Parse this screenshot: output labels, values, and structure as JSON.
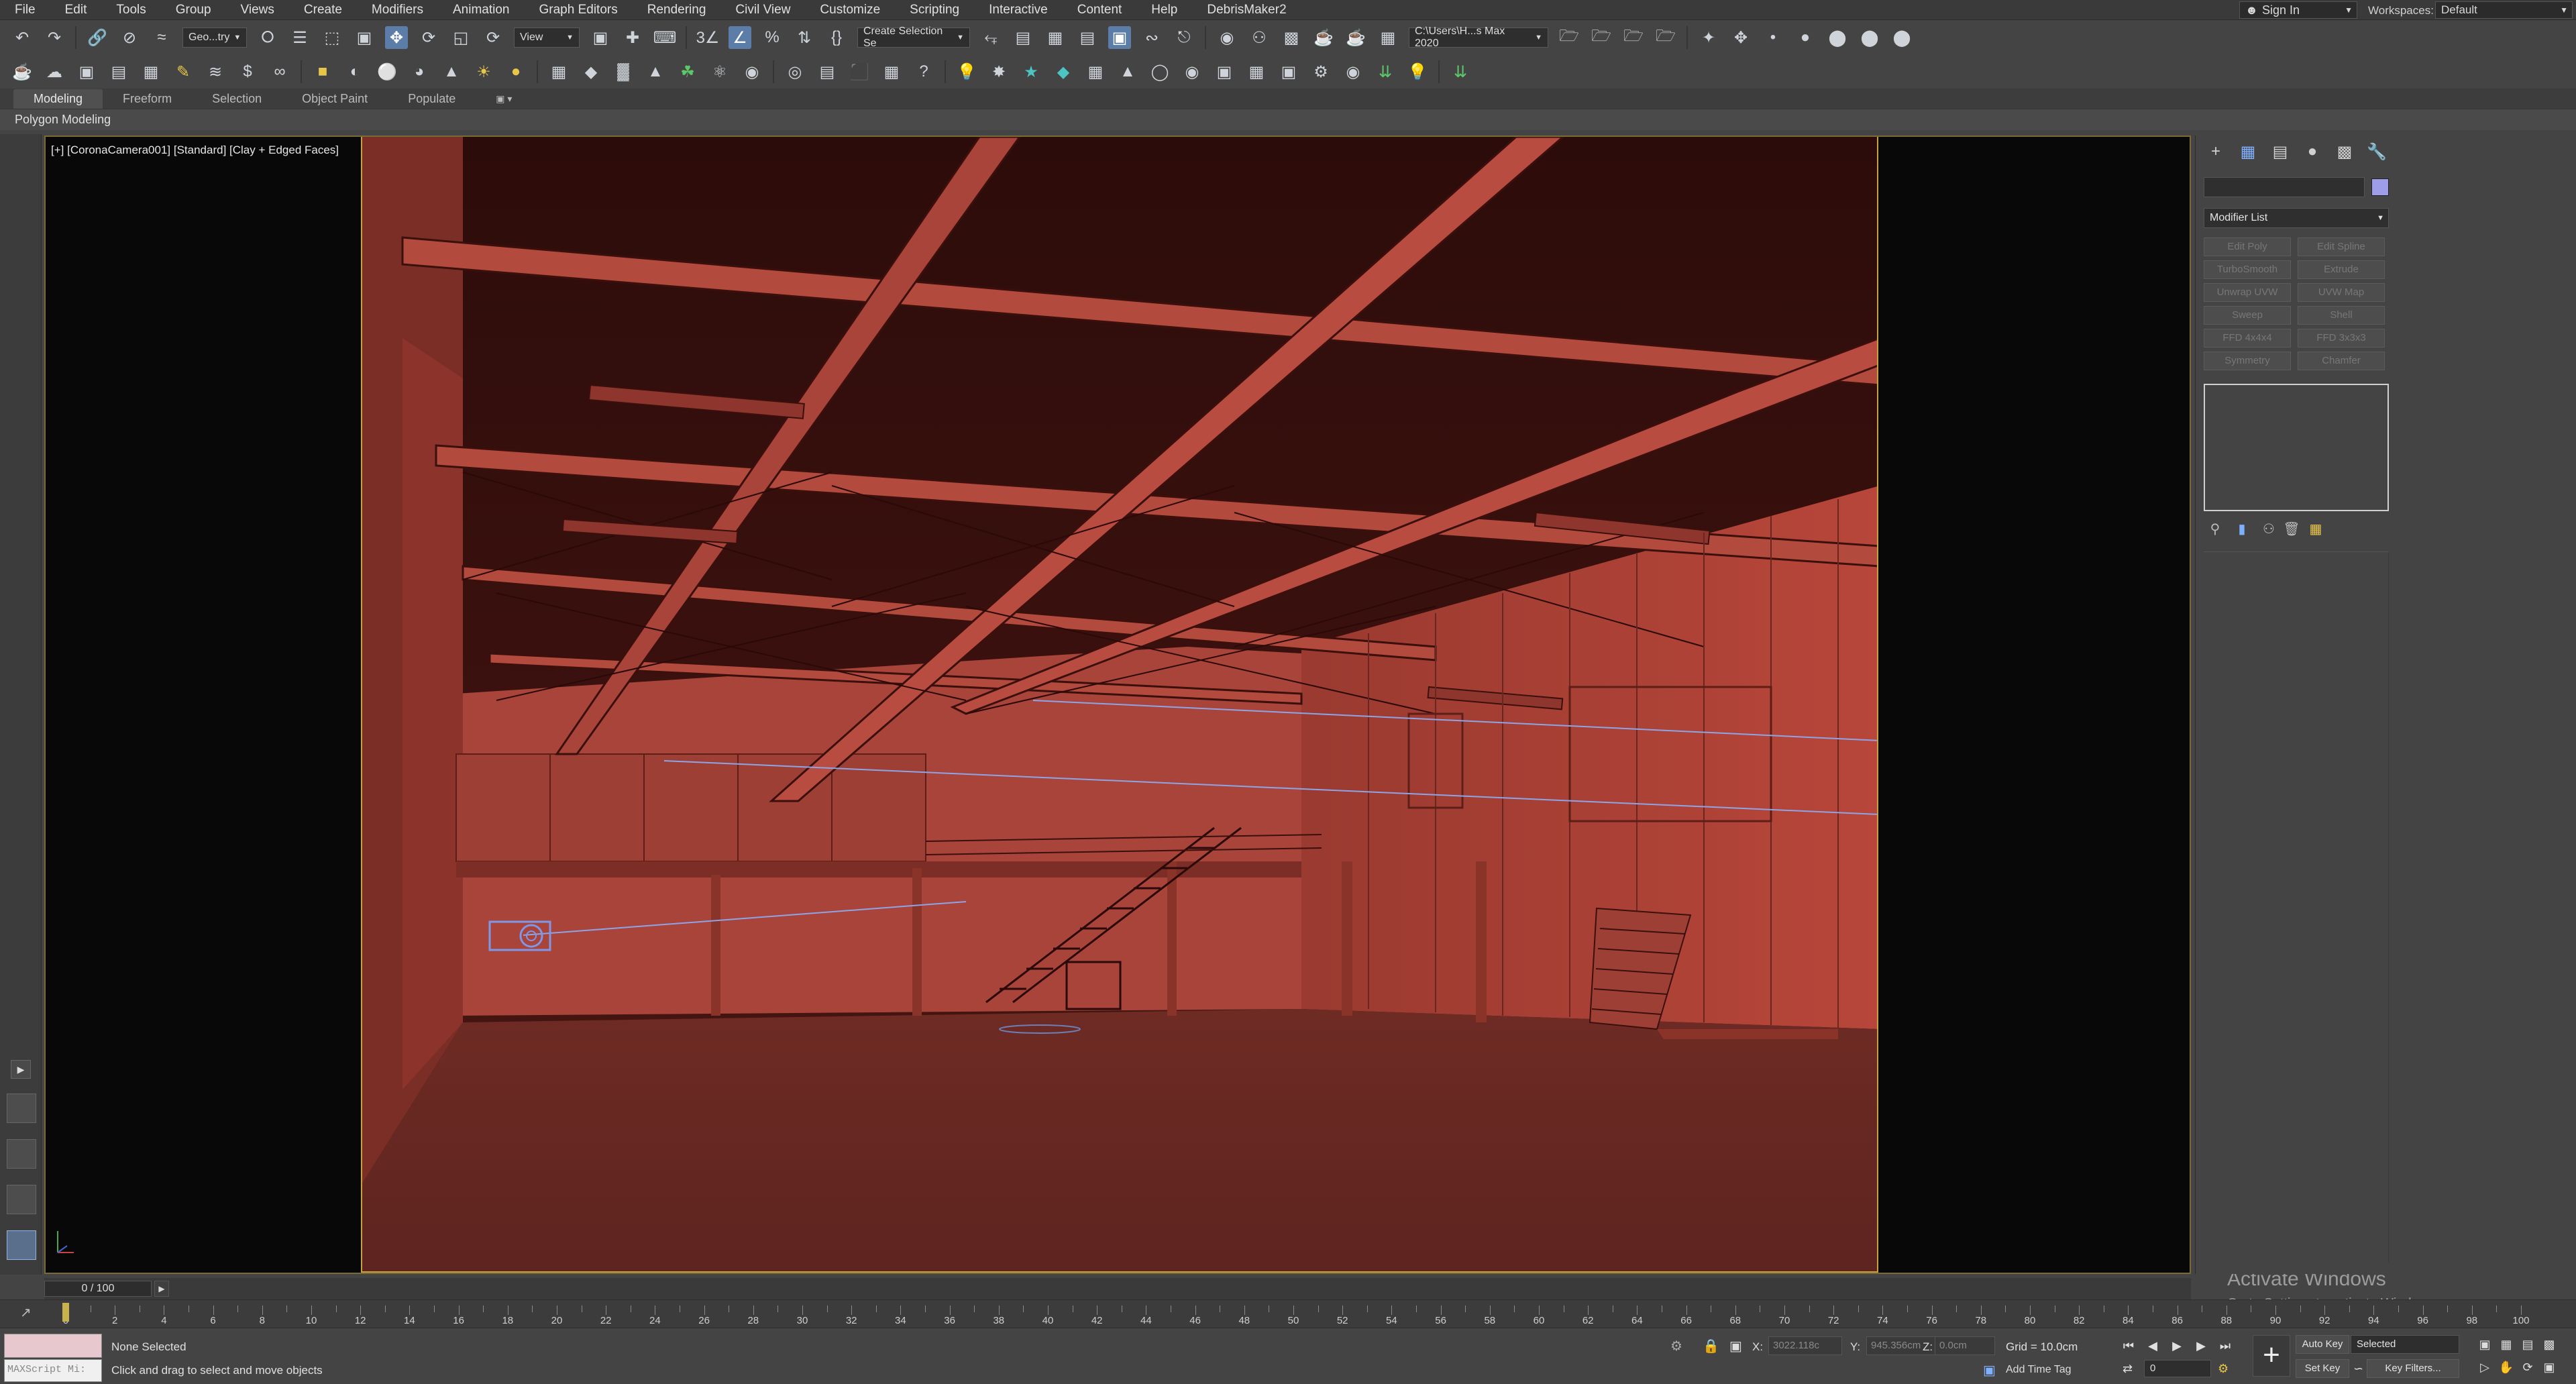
{
  "menu": [
    "File",
    "Edit",
    "Tools",
    "Group",
    "Views",
    "Create",
    "Modifiers",
    "Animation",
    "Graph Editors",
    "Rendering",
    "Civil View",
    "Customize",
    "Scripting",
    "Interactive",
    "Content",
    "Help",
    "DebrisMaker2"
  ],
  "account": {
    "sign_in": "Sign In",
    "workspaces_label": "Workspaces:",
    "workspace": "Default"
  },
  "toolbar1": {
    "geometry_filter": "Geo...try",
    "ref_coord": "View",
    "selection_set": "Create Selection Se",
    "project_path": "C:\\Users\\H...s Max 2020"
  },
  "ribbon": {
    "tabs": [
      "Modeling",
      "Freeform",
      "Selection",
      "Object Paint",
      "Populate"
    ],
    "active_tab": "Modeling",
    "panel_title": "Polygon Modeling"
  },
  "viewport": {
    "label": "[+] [CoronaCamera001] [Standard] [Clay + Edged Faces]",
    "watermark_title": "Activate Windows",
    "watermark_sub": "Go to Settings to activate Windows."
  },
  "command_panel": {
    "modifier_list": "Modifier List",
    "modifier_buttons": [
      "Edit Poly",
      "Edit Spline",
      "TurboSmooth",
      "Extrude",
      "Unwrap UVW",
      "UVW Map",
      "Sweep",
      "Shell",
      "FFD 4x4x4",
      "FFD 3x3x3",
      "Symmetry",
      "Chamfer"
    ],
    "light_color": "#9d9de8"
  },
  "timeline": {
    "frame_display": "0 / 100",
    "tick_labels": [
      "0",
      "2",
      "4",
      "6",
      "8",
      "10",
      "12",
      "14",
      "16",
      "18",
      "20",
      "22",
      "24",
      "26",
      "28",
      "30",
      "32",
      "34",
      "36",
      "38",
      "40",
      "42",
      "44",
      "46",
      "48",
      "50",
      "52",
      "54",
      "56",
      "58",
      "60",
      "62",
      "64",
      "66",
      "68",
      "70",
      "72",
      "74",
      "76",
      "78",
      "80",
      "82",
      "84",
      "86",
      "88",
      "90",
      "92",
      "94",
      "96",
      "98",
      "100"
    ],
    "current_frame": 0
  },
  "status": {
    "maxscript": "MAXScript Mi:",
    "selection": "None Selected",
    "prompt": "Click and drag to select and move objects",
    "x_label": "X:",
    "x_value": "3022.118c",
    "y_label": "Y:",
    "y_value": "945.356cm",
    "z_label": "Z:",
    "z_value": "0.0cm",
    "grid": "Grid = 10.0cm",
    "add_time_tag": "Add Time Tag",
    "frame_field": "0",
    "auto_key": "Auto Key",
    "set_key": "Set Key",
    "key_mode": "Selected",
    "key_filters": "Key Filters..."
  },
  "colors": {
    "accent_active": "#5b7da8",
    "viewport_frame": "#c6a23e",
    "scene_base": "#a8443a"
  }
}
